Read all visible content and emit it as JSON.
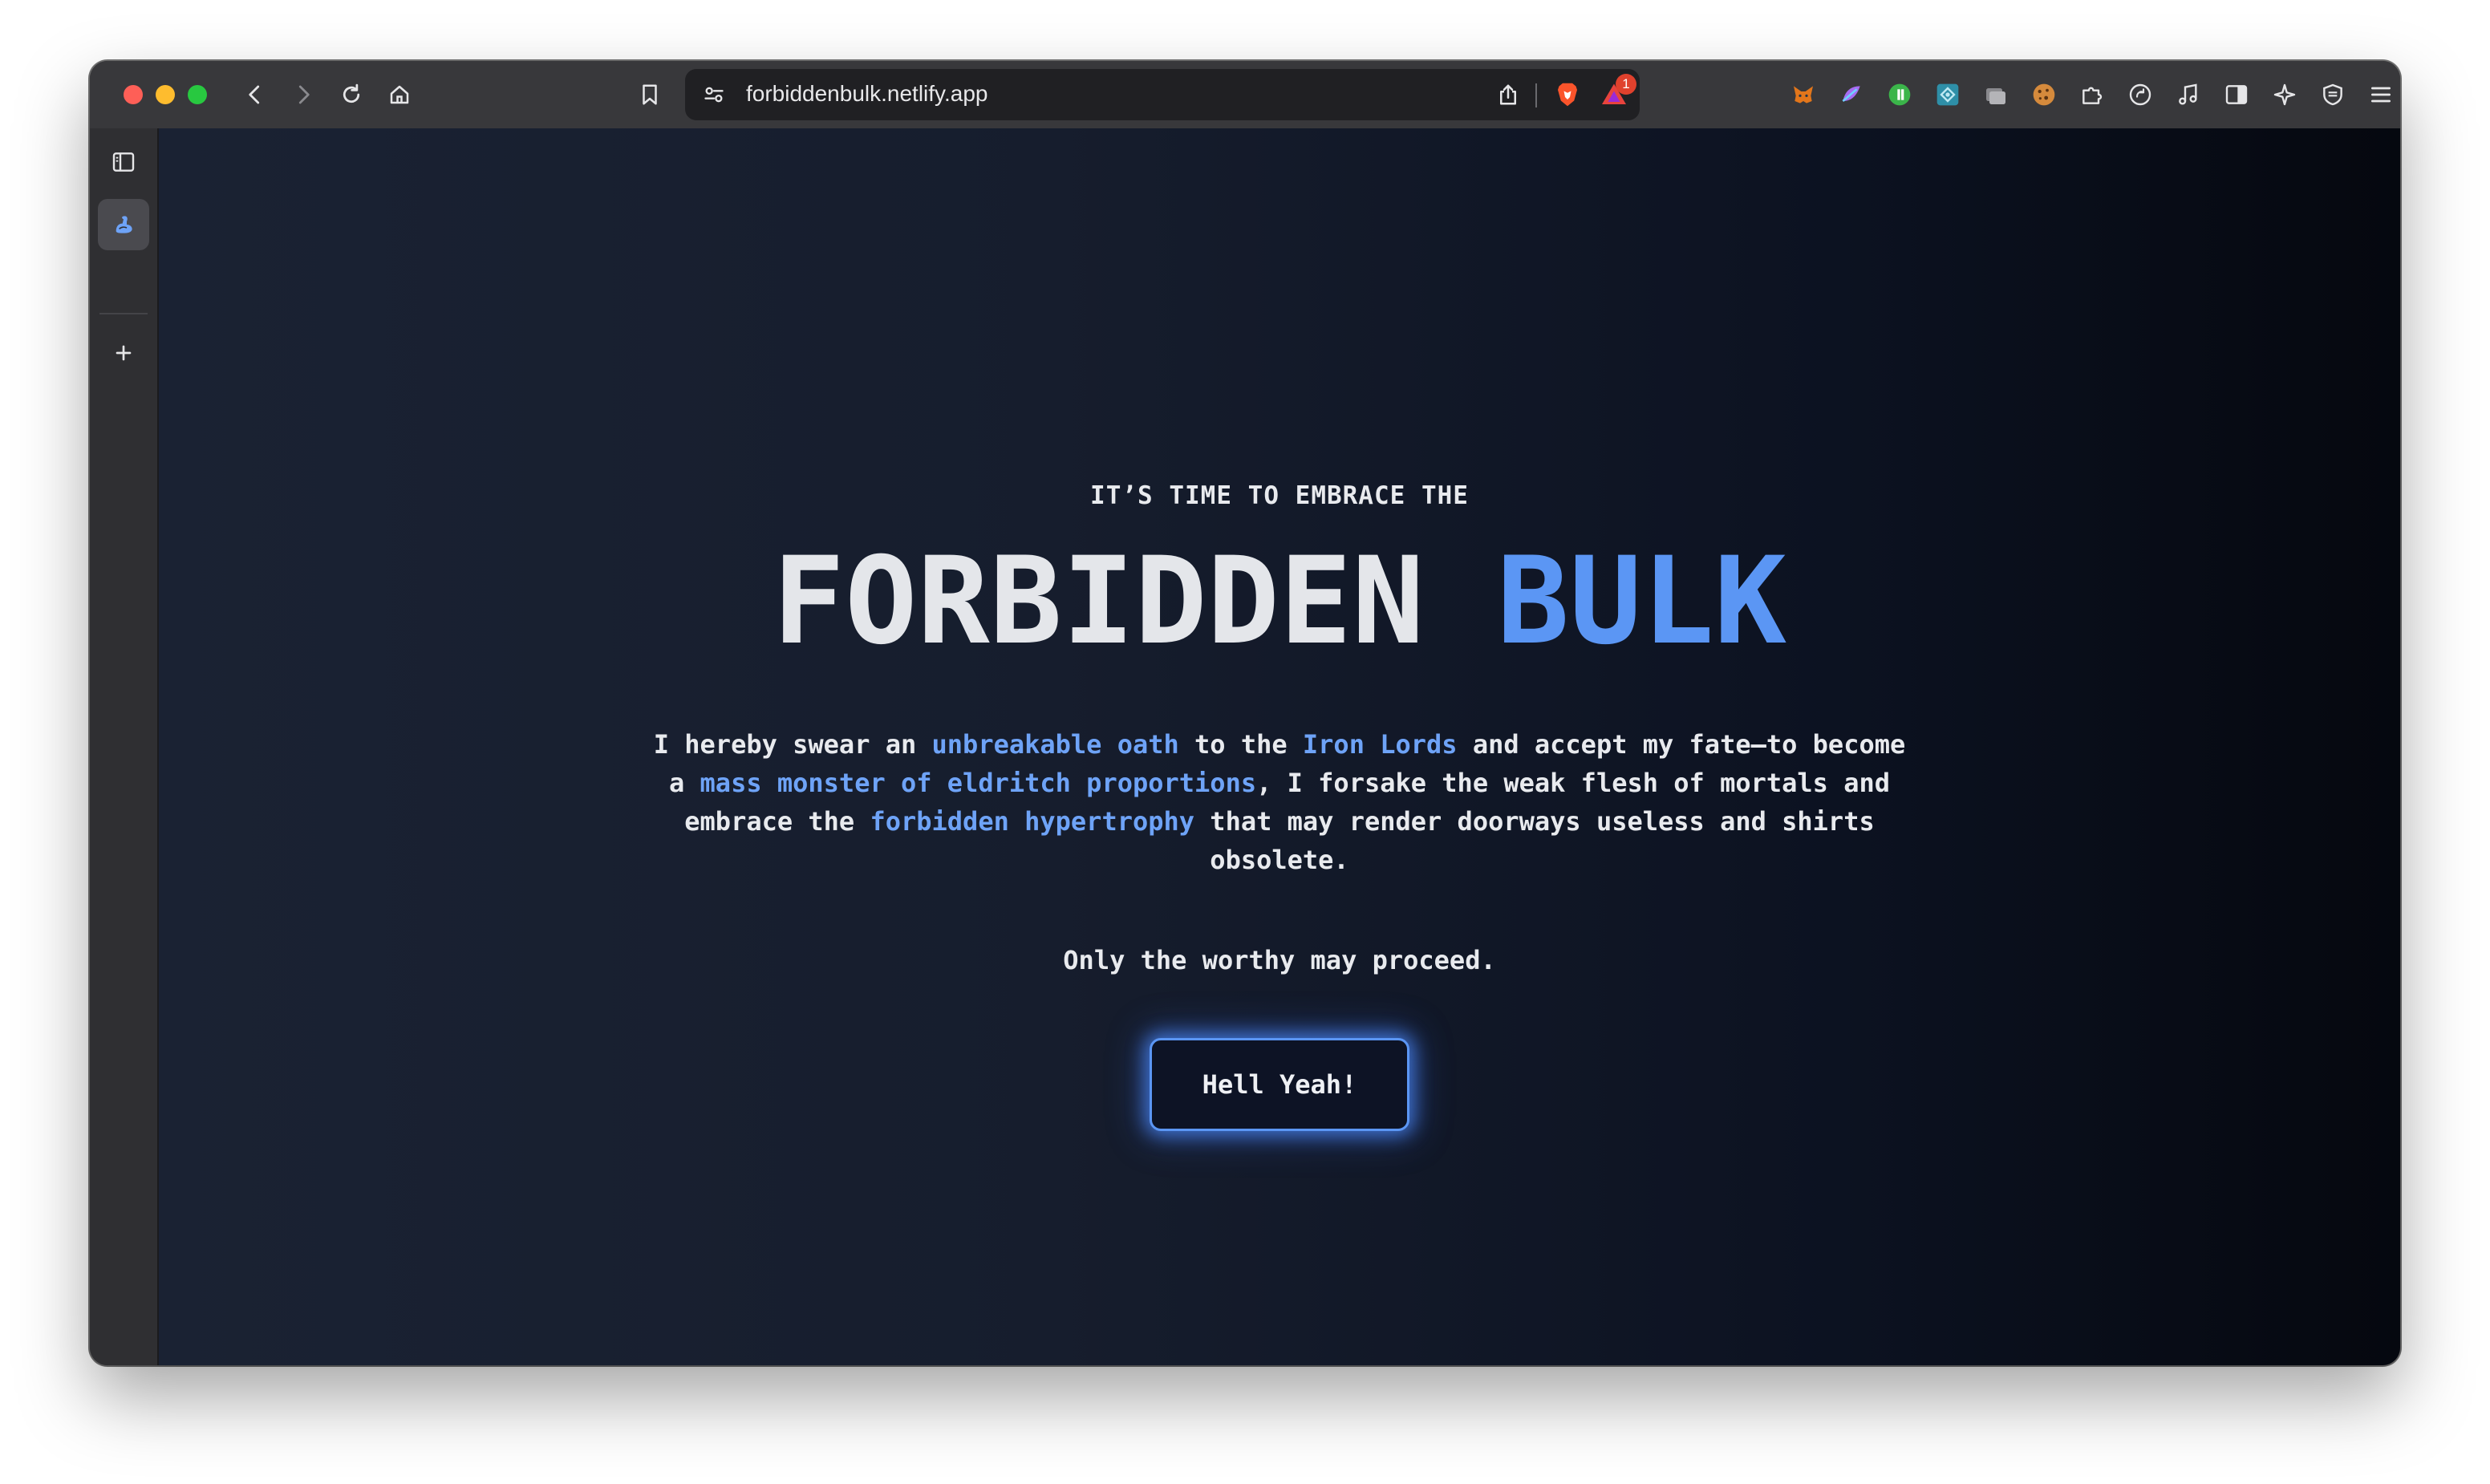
{
  "browser": {
    "url": "forbiddenbulk.netlify.app",
    "notification_count": "1",
    "extensions": [
      "metamask-fox-icon",
      "purple-extension-icon",
      "green-extension-icon",
      "teal-extension-icon",
      "tab-groups-icon",
      "cookie-icon",
      "puzzle-icon",
      "sync-icon",
      "music-icon",
      "split-view-icon",
      "leo-ai-icon",
      "vpn-shield-icon",
      "menu-icon"
    ]
  },
  "sidebar": {
    "items": [
      "sidebar-toggle-icon",
      "bicep-app-icon",
      "add-icon"
    ]
  },
  "page": {
    "eyebrow": "IT’S TIME TO EMBRACE THE",
    "headline_main": "FORBIDDEN ",
    "headline_accent": "BULK",
    "oath": {
      "t1": "I hereby swear an ",
      "h1": "unbreakable oath",
      "t2": " to the ",
      "h2": "Iron Lords",
      "t3": " and accept my fate—to become a ",
      "h3": "mass monster of eldritch proportions",
      "t4": ", I forsake the weak flesh of mortals and embrace the ",
      "h4": "forbidden hypertrophy",
      "t5": " that may render doorways useless and shirts obsolete."
    },
    "worthy": "Only the worthy may proceed.",
    "cta_label": "Hell Yeah!"
  },
  "colors": {
    "accent": "#5b96f4",
    "background_start": "#1a2233",
    "background_end": "#05080f"
  }
}
